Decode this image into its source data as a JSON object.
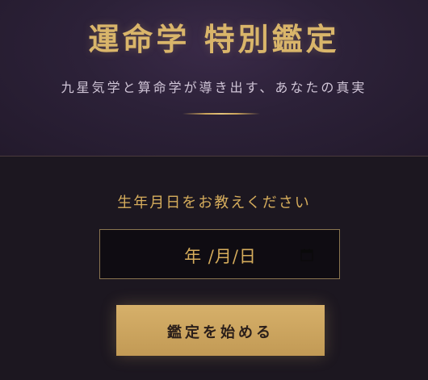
{
  "header": {
    "title": "運命学 特別鑑定",
    "subtitle": "九星気学と算命学が導き出す、あなたの真実"
  },
  "form": {
    "prompt": "生年月日をお教えください",
    "date_input": {
      "display_value": "年 /月/日",
      "icon": "calendar-icon"
    },
    "submit_label": "鑑定を始める"
  },
  "colors": {
    "accent_gold": "#d6ad5c",
    "header_bg": "#2c2138",
    "body_bg": "#1c1720"
  }
}
